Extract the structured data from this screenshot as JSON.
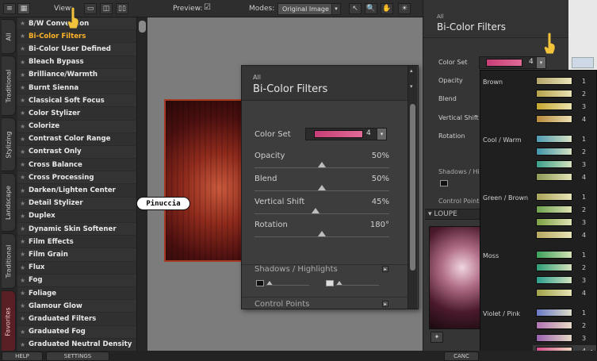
{
  "toolbar": {
    "view_label": "View:",
    "preview_label": "Preview:",
    "preview_check": "☑",
    "modes_label": "Modes:",
    "modes_value": "Original Image",
    "modes_arrow": "▾",
    "tool_icons": [
      "↖",
      "🔍",
      "✋",
      "☀"
    ]
  },
  "vertical_tabs": [
    "All",
    "Traditional",
    "Stylizing",
    "Landscape",
    "Traditional",
    "Favorites"
  ],
  "filters": [
    "B/W Conversion",
    "Bi-Color Filters",
    "Bi-Color User Defined",
    "Bleach Bypass",
    "Brilliance/Warmth",
    "Burnt Sienna",
    "Classical Soft Focus",
    "Color Stylizer",
    "Colorize",
    "Contrast Color Range",
    "Contrast Only",
    "Cross Balance",
    "Cross Processing",
    "Darken/Lighten Center",
    "Detail Stylizer",
    "Duplex",
    "Dynamic Skin Softener",
    "Film Effects",
    "Film Grain",
    "Flux",
    "Fog",
    "Foliage",
    "Glamour Glow",
    "Graduated Filters",
    "Graduated Fog",
    "Graduated Neutral Density"
  ],
  "active_filter_index": 1,
  "watermark": "Pinuccia",
  "panel": {
    "category": "All",
    "title": "Bi-Color Filters",
    "color_set_label": "Color Set",
    "color_set_value": "4",
    "opacity_label": "Opacity",
    "opacity_value": "50%",
    "opacity_pct": 50,
    "blend_label": "Blend",
    "blend_value": "50%",
    "blend_pct": 50,
    "vshift_label": "Vertical Shift",
    "vshift_value": "45%",
    "vshift_pct": 45,
    "rotation_label": "Rotation",
    "rotation_value": "180°",
    "rotation_pct": 50,
    "shadows_label": "Shadows / Highlights",
    "control_points_label": "Control Points"
  },
  "right_panel": {
    "category": "All",
    "title": "Bi-Color Filters",
    "color_set_label": "Color Set",
    "color_set_value": "4",
    "opacity_label": "Opacity",
    "blend_label": "Blend",
    "vshift_label": "Vertical Shift",
    "rotation_label": "Rotation",
    "shadows_label": "Shadows / Hig",
    "control_points_label": "Control Points",
    "loupe_label": "LOUPE"
  },
  "color_sets": [
    {
      "group": "Brown",
      "swatches": [
        {
          "num": "1",
          "color": "#b3a56a"
        },
        {
          "num": "2",
          "color": "#b6a24b"
        },
        {
          "num": "3",
          "color": "#c6a62e"
        },
        {
          "num": "4",
          "color": "#b78b3c"
        }
      ]
    },
    {
      "group": "Cool / Warm",
      "swatches": [
        {
          "num": "1",
          "color": "#4e9cb0"
        },
        {
          "num": "2",
          "color": "#3f95a8"
        },
        {
          "num": "3",
          "color": "#3aa08c"
        },
        {
          "num": "4",
          "color": "#8d9a55"
        }
      ]
    },
    {
      "group": "Green / Brown",
      "swatches": [
        {
          "num": "1",
          "color": "#a8a45a"
        },
        {
          "num": "2",
          "color": "#6ea24e"
        },
        {
          "num": "3",
          "color": "#7ca144"
        },
        {
          "num": "4",
          "color": "#b5a85e"
        }
      ]
    },
    {
      "group": "Moss",
      "swatches": [
        {
          "num": "1",
          "color": "#3aa05a"
        },
        {
          "num": "2",
          "color": "#2f9d79"
        },
        {
          "num": "3",
          "color": "#2a9e8e"
        },
        {
          "num": "4",
          "color": "#a1a24a"
        }
      ]
    },
    {
      "group": "Violet / Pink",
      "swatches": [
        {
          "num": "1",
          "color": "#6a7ac6"
        },
        {
          "num": "2",
          "color": "#b073b3"
        },
        {
          "num": "3",
          "color": "#9a62ae"
        },
        {
          "num": "4",
          "color": "#d3508e"
        }
      ]
    }
  ],
  "selected_marker": "◂",
  "bottom": {
    "help": "HELP",
    "settings": "SETTINGS",
    "cancel": "CANC"
  }
}
